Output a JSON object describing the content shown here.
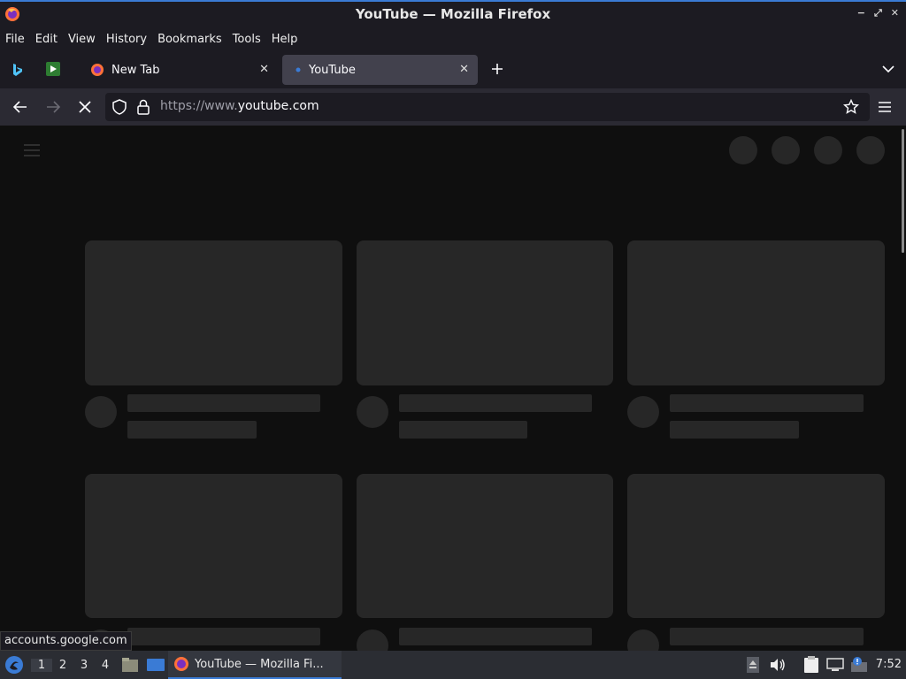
{
  "window": {
    "title": "YouTube — Mozilla Firefox",
    "wm_buttons": [
      "−",
      "⤢",
      "✕"
    ]
  },
  "menu": [
    {
      "label": "File"
    },
    {
      "label": "Edit"
    },
    {
      "label": "View"
    },
    {
      "label": "History"
    },
    {
      "label": "Bookmarks"
    },
    {
      "label": "Tools"
    },
    {
      "label": "Help"
    }
  ],
  "tabs": [
    {
      "label": "New Tab",
      "icon": "firefox-icon",
      "active": false
    },
    {
      "label": "YouTube",
      "icon": "loading-dot-icon",
      "active": true
    }
  ],
  "navbar": {
    "url_prefix": "https://www.",
    "url_domain": "youtube.com"
  },
  "status_text": "accounts.google.com",
  "taskbar": {
    "workspaces": [
      "1",
      "2",
      "3",
      "4"
    ],
    "active_task": "YouTube — Mozilla Fi...",
    "clock": "7:52"
  },
  "colors": {
    "accent": "#3a7bd5",
    "page_bg": "#0f0f0f",
    "skeleton": "#272727"
  }
}
